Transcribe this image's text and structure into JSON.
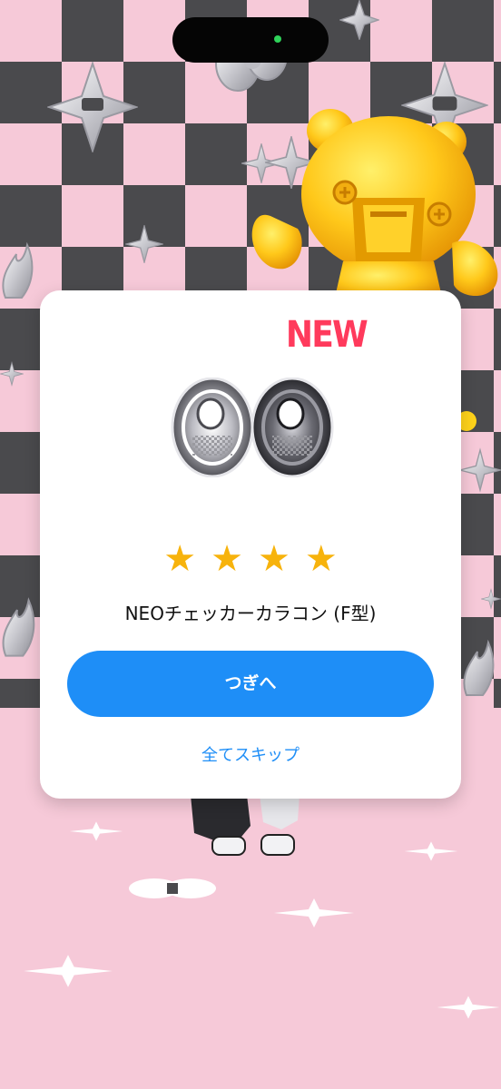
{
  "reward": {
    "badge": "NEW",
    "item_name": "NEOチェッカーカラコン (F型)",
    "rarity_stars": 4,
    "star_glyphs": [
      "★",
      "★",
      "★",
      "★"
    ],
    "item_icon": "checker-contact-lens-icon"
  },
  "actions": {
    "next_label": "つぎへ",
    "skip_all_label": "全てスキップ"
  },
  "colors": {
    "accent_blue": "#1e8ef7",
    "new_badge": "#ff3a5c",
    "star": "#f7b30c",
    "checker_dark": "#4a4a4d",
    "checker_pink": "#f6c9d8"
  }
}
